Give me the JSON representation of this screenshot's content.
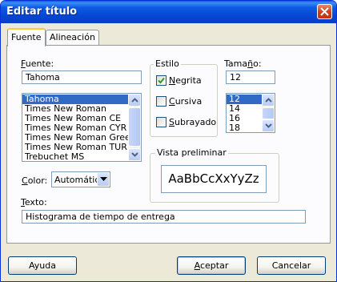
{
  "window": {
    "title": "Editar título"
  },
  "tabs": [
    {
      "label": "Fuente",
      "active": true
    },
    {
      "label": "Alineación",
      "active": false
    }
  ],
  "font": {
    "label_accel": "F",
    "label_rest": "uente:",
    "value": "Tahoma",
    "list": [
      "Tahoma",
      "Times New Roman",
      "Times New Roman CE",
      "Times New Roman CYR",
      "Times New Roman Greek",
      "Times New Roman TUR",
      "Trebuchet MS"
    ],
    "selected": "Tahoma"
  },
  "style": {
    "group_label": "Estilo",
    "bold": {
      "accel": "N",
      "rest": "egrita",
      "checked": true
    },
    "italic": {
      "accel": "C",
      "rest": "ursiva",
      "checked": false
    },
    "underline": {
      "accel": "S",
      "rest": "ubrayado",
      "checked": false
    }
  },
  "size": {
    "label_pre": "Tama",
    "label_accel": "ñ",
    "label_post": "o:",
    "value": "12",
    "list": [
      "12",
      "14",
      "16",
      "18"
    ],
    "selected": "12"
  },
  "color": {
    "label_accel": "C",
    "label_rest": "olor:",
    "value": "Automático"
  },
  "preview": {
    "group_label": "Vista preliminar",
    "sample": "AaBbCcXxYyZz"
  },
  "text": {
    "label_accel": "T",
    "label_rest": "exto:",
    "value": "Histograma de tiempo de entrega"
  },
  "buttons": {
    "help": "Ayuda",
    "ok_accel": "A",
    "ok_rest": "ceptar",
    "cancel": "Cancelar"
  },
  "colors": {
    "title_bar": "#0a58e0",
    "selection": "#316ac5",
    "dialog_bg": "#ece9d8",
    "close_button": "#d0431d"
  }
}
